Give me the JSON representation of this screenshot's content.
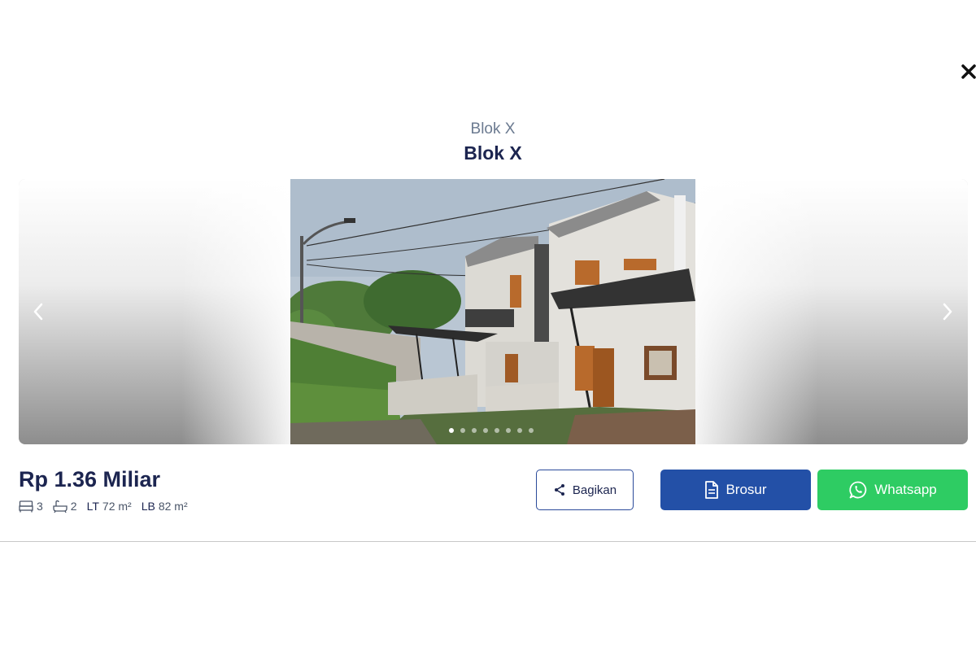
{
  "header": {
    "subtitle": "Blok X",
    "title": "Blok X",
    "close_icon": "close-icon"
  },
  "carousel": {
    "prev_icon": "chevron-left-icon",
    "next_icon": "chevron-right-icon",
    "slide_count": 8,
    "active_index": 0
  },
  "listing": {
    "price": "Rp 1.36 Miliar",
    "bedrooms": "3",
    "bathrooms": "2",
    "land_area_label": "LT",
    "land_area": "72 m²",
    "building_area_label": "LB",
    "building_area": "82 m²"
  },
  "actions": {
    "share_label": "Bagikan",
    "brochure_label": "Brosur",
    "whatsapp_label": "Whatsapp"
  },
  "colors": {
    "title": "#1c2550",
    "brochure": "#2350a7",
    "whatsapp": "#2ecc63"
  }
}
